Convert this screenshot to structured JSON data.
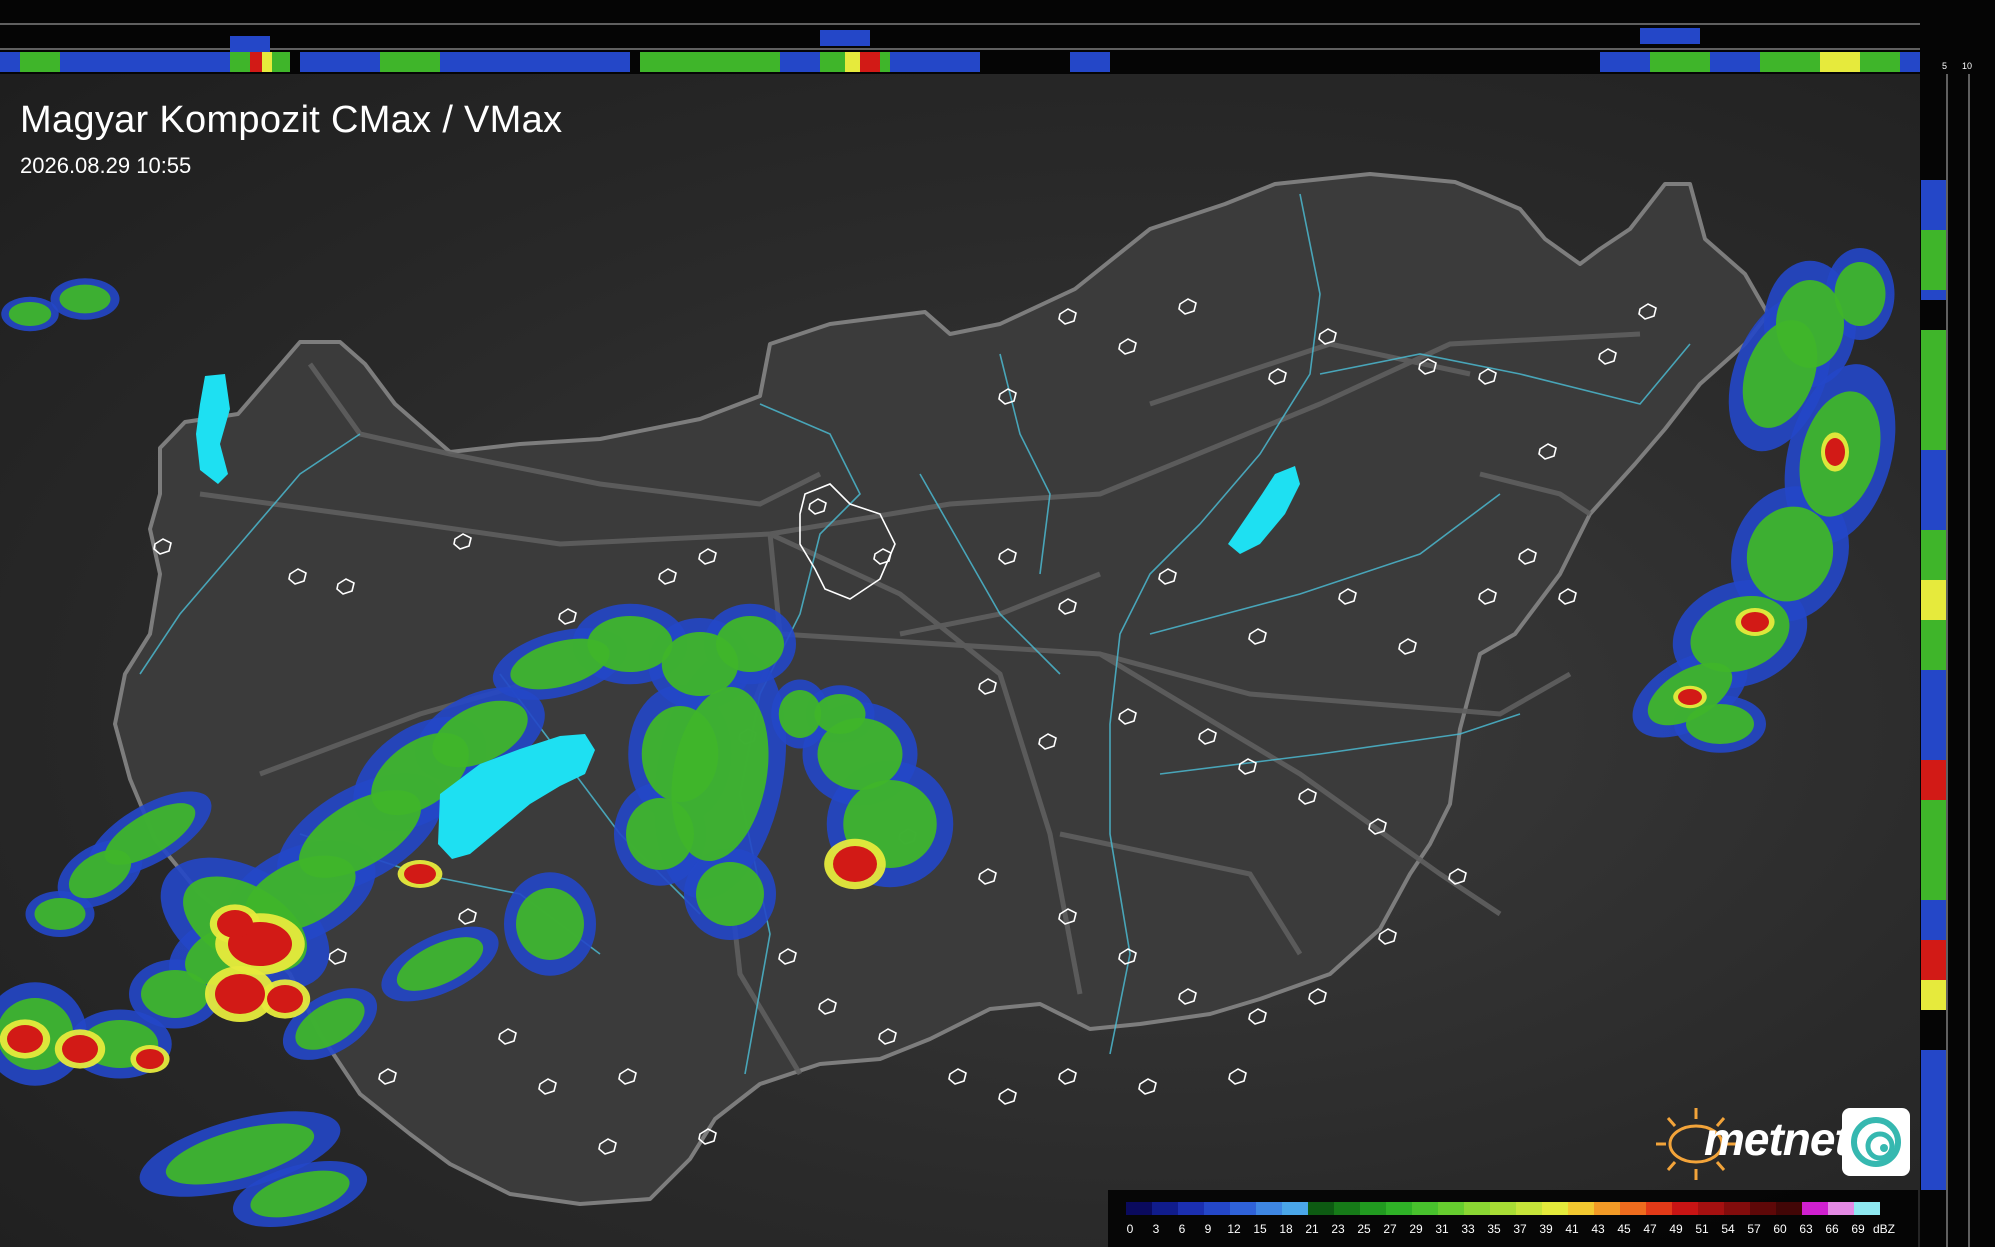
{
  "title": "Magyar Kompozit CMax / VMax",
  "timestamp": "2026.08.29 10:55",
  "logo": {
    "brand": "metnet"
  },
  "profile_scales": {
    "top_axis": [
      "10",
      "5"
    ],
    "right_axis": [
      "5",
      "10"
    ]
  },
  "legend": {
    "unit": "dBZ",
    "values": [
      "0",
      "3",
      "6",
      "9",
      "12",
      "15",
      "18",
      "21",
      "23",
      "25",
      "27",
      "29",
      "31",
      "33",
      "35",
      "37",
      "39",
      "41",
      "43",
      "45",
      "47",
      "49",
      "51",
      "54",
      "57",
      "60",
      "63",
      "66",
      "69"
    ],
    "colors": [
      "#0a0a5e",
      "#101c8c",
      "#1b2fb0",
      "#2447c8",
      "#2f62d8",
      "#3e86e2",
      "#4aa6e8",
      "#0d5a12",
      "#167a18",
      "#219a20",
      "#2fb127",
      "#48c12d",
      "#66cc2f",
      "#8ad633",
      "#a8dc35",
      "#c6e43a",
      "#e4ea3c",
      "#f2c830",
      "#f29a26",
      "#ee6c1e",
      "#e23a18",
      "#c81414",
      "#a51010",
      "#820c0c",
      "#5e0808",
      "#420606",
      "#d020d0",
      "#e48ae4",
      "#8ee8f0"
    ]
  },
  "map": {
    "layers": [
      "radar-echoes",
      "country-border",
      "rivers",
      "lakes",
      "roads",
      "urban-areas"
    ]
  }
}
